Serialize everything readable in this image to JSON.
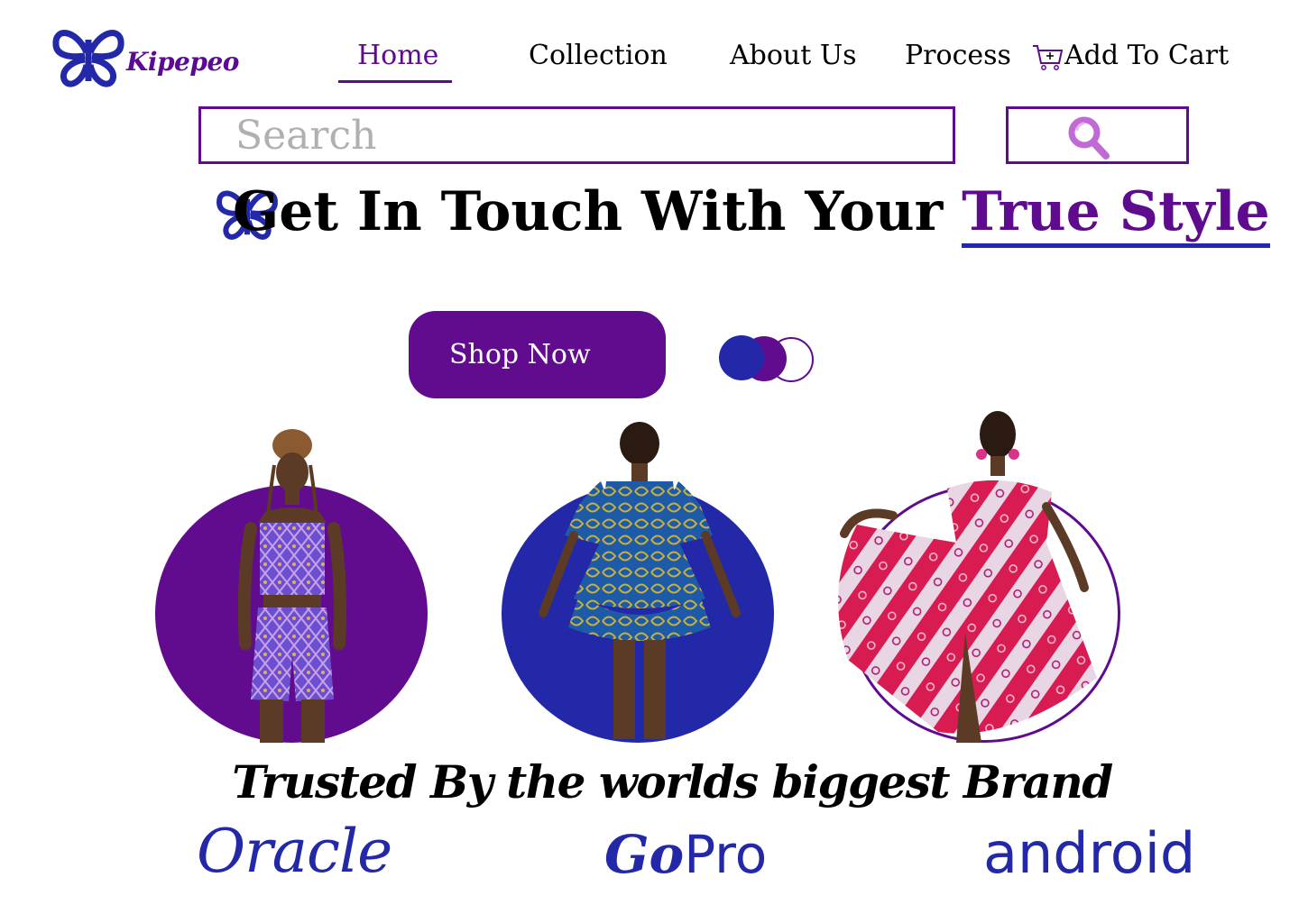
{
  "logo": {
    "text": "Kipepeo"
  },
  "nav": {
    "items": [
      {
        "label": "Home",
        "active": true
      },
      {
        "label": "Collection"
      },
      {
        "label": "About Us"
      },
      {
        "label": "Process"
      }
    ],
    "cart_label": "Add To Cart"
  },
  "search": {
    "placeholder": "Search"
  },
  "hero": {
    "title_prefix": "Get In Touch With Your ",
    "title_accent": "True Style",
    "cta": "Shop Now"
  },
  "carousel": {
    "dots": 3
  },
  "products": [
    {
      "name": "purple-print-two-piece",
      "circle_color": "#610b8f"
    },
    {
      "name": "blue-puff-sleeve-dress",
      "circle_color": "#2228a8"
    },
    {
      "name": "red-print-maxi-dress",
      "circle_color": "#ffffff"
    }
  ],
  "trusted": {
    "heading": "Trusted By the worlds biggest Brand"
  },
  "brands": {
    "oracle": "Oracle",
    "gopro_go": "Go",
    "gopro_pro": "Pro",
    "android": "android"
  },
  "colors": {
    "purple": "#5f0b8f",
    "blue": "#2228a8",
    "white": "#ffffff",
    "black": "#000000"
  }
}
